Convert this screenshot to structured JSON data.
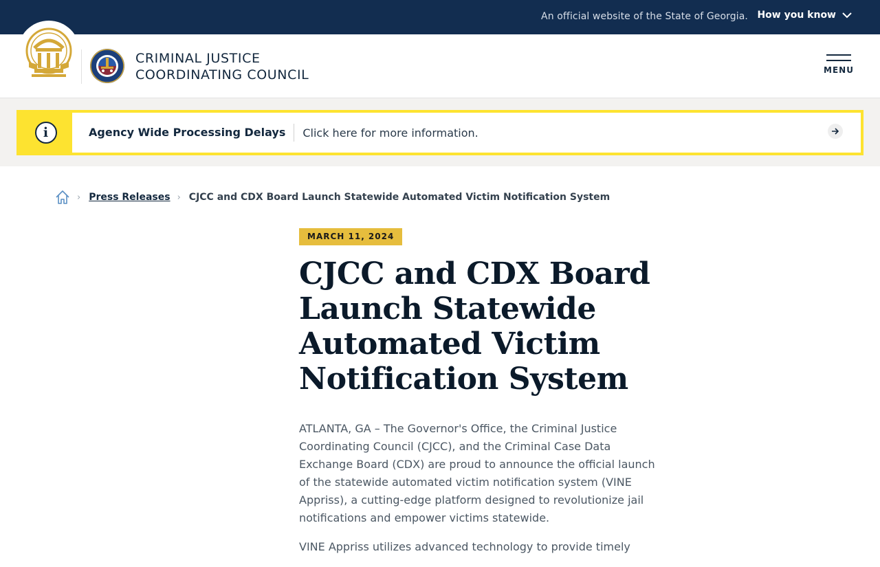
{
  "gov_bar": {
    "official_text": "An official website of the State of Georgia.",
    "how_you_know": "How you know"
  },
  "header": {
    "agency_line1": "Criminal Justice",
    "agency_line2": "Coordinating Council",
    "menu_label": "MENU"
  },
  "alert": {
    "title": "Agency Wide Processing Delays",
    "message": "Click here for more information.",
    "icon_glyph": "i"
  },
  "breadcrumb": {
    "parent": "Press Releases",
    "current": "CJCC and CDX Board Launch Statewide Automated Victim Notification System"
  },
  "article": {
    "date": "MARCH 11, 2024",
    "title": "CJCC and CDX Board Launch Statewide Automated Victim Notification System",
    "paragraph1": "ATLANTA, GA – The Governor's Office, the Criminal Justice Coordinating Council (CJCC), and the Criminal Case Data Exchange Board (CDX) are proud to announce the official launch of the statewide automated victim notification system (VINE Appriss), a cutting-edge platform designed to revolutionize jail notifications and empower victims statewide.",
    "paragraph2": "VINE Appriss utilizes advanced technology to provide timely"
  },
  "colors": {
    "navy": "#122d50",
    "alert_yellow": "#fde330",
    "date_gold": "#e6bd3d"
  }
}
